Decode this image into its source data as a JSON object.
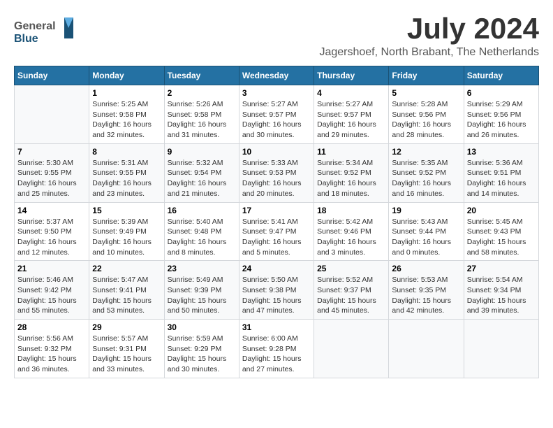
{
  "header": {
    "logo": {
      "general": "General",
      "blue": "Blue"
    },
    "title": "July 2024",
    "location": "Jagershoef, North Brabant, The Netherlands"
  },
  "calendar": {
    "days_of_week": [
      "Sunday",
      "Monday",
      "Tuesday",
      "Wednesday",
      "Thursday",
      "Friday",
      "Saturday"
    ],
    "weeks": [
      [
        {
          "day": "",
          "info": ""
        },
        {
          "day": "1",
          "info": "Sunrise: 5:25 AM\nSunset: 9:58 PM\nDaylight: 16 hours\nand 32 minutes."
        },
        {
          "day": "2",
          "info": "Sunrise: 5:26 AM\nSunset: 9:58 PM\nDaylight: 16 hours\nand 31 minutes."
        },
        {
          "day": "3",
          "info": "Sunrise: 5:27 AM\nSunset: 9:57 PM\nDaylight: 16 hours\nand 30 minutes."
        },
        {
          "day": "4",
          "info": "Sunrise: 5:27 AM\nSunset: 9:57 PM\nDaylight: 16 hours\nand 29 minutes."
        },
        {
          "day": "5",
          "info": "Sunrise: 5:28 AM\nSunset: 9:56 PM\nDaylight: 16 hours\nand 28 minutes."
        },
        {
          "day": "6",
          "info": "Sunrise: 5:29 AM\nSunset: 9:56 PM\nDaylight: 16 hours\nand 26 minutes."
        }
      ],
      [
        {
          "day": "7",
          "info": "Sunrise: 5:30 AM\nSunset: 9:55 PM\nDaylight: 16 hours\nand 25 minutes."
        },
        {
          "day": "8",
          "info": "Sunrise: 5:31 AM\nSunset: 9:55 PM\nDaylight: 16 hours\nand 23 minutes."
        },
        {
          "day": "9",
          "info": "Sunrise: 5:32 AM\nSunset: 9:54 PM\nDaylight: 16 hours\nand 21 minutes."
        },
        {
          "day": "10",
          "info": "Sunrise: 5:33 AM\nSunset: 9:53 PM\nDaylight: 16 hours\nand 20 minutes."
        },
        {
          "day": "11",
          "info": "Sunrise: 5:34 AM\nSunset: 9:52 PM\nDaylight: 16 hours\nand 18 minutes."
        },
        {
          "day": "12",
          "info": "Sunrise: 5:35 AM\nSunset: 9:52 PM\nDaylight: 16 hours\nand 16 minutes."
        },
        {
          "day": "13",
          "info": "Sunrise: 5:36 AM\nSunset: 9:51 PM\nDaylight: 16 hours\nand 14 minutes."
        }
      ],
      [
        {
          "day": "14",
          "info": "Sunrise: 5:37 AM\nSunset: 9:50 PM\nDaylight: 16 hours\nand 12 minutes."
        },
        {
          "day": "15",
          "info": "Sunrise: 5:39 AM\nSunset: 9:49 PM\nDaylight: 16 hours\nand 10 minutes."
        },
        {
          "day": "16",
          "info": "Sunrise: 5:40 AM\nSunset: 9:48 PM\nDaylight: 16 hours\nand 8 minutes."
        },
        {
          "day": "17",
          "info": "Sunrise: 5:41 AM\nSunset: 9:47 PM\nDaylight: 16 hours\nand 5 minutes."
        },
        {
          "day": "18",
          "info": "Sunrise: 5:42 AM\nSunset: 9:46 PM\nDaylight: 16 hours\nand 3 minutes."
        },
        {
          "day": "19",
          "info": "Sunrise: 5:43 AM\nSunset: 9:44 PM\nDaylight: 16 hours\nand 0 minutes."
        },
        {
          "day": "20",
          "info": "Sunrise: 5:45 AM\nSunset: 9:43 PM\nDaylight: 15 hours\nand 58 minutes."
        }
      ],
      [
        {
          "day": "21",
          "info": "Sunrise: 5:46 AM\nSunset: 9:42 PM\nDaylight: 15 hours\nand 55 minutes."
        },
        {
          "day": "22",
          "info": "Sunrise: 5:47 AM\nSunset: 9:41 PM\nDaylight: 15 hours\nand 53 minutes."
        },
        {
          "day": "23",
          "info": "Sunrise: 5:49 AM\nSunset: 9:39 PM\nDaylight: 15 hours\nand 50 minutes."
        },
        {
          "day": "24",
          "info": "Sunrise: 5:50 AM\nSunset: 9:38 PM\nDaylight: 15 hours\nand 47 minutes."
        },
        {
          "day": "25",
          "info": "Sunrise: 5:52 AM\nSunset: 9:37 PM\nDaylight: 15 hours\nand 45 minutes."
        },
        {
          "day": "26",
          "info": "Sunrise: 5:53 AM\nSunset: 9:35 PM\nDaylight: 15 hours\nand 42 minutes."
        },
        {
          "day": "27",
          "info": "Sunrise: 5:54 AM\nSunset: 9:34 PM\nDaylight: 15 hours\nand 39 minutes."
        }
      ],
      [
        {
          "day": "28",
          "info": "Sunrise: 5:56 AM\nSunset: 9:32 PM\nDaylight: 15 hours\nand 36 minutes."
        },
        {
          "day": "29",
          "info": "Sunrise: 5:57 AM\nSunset: 9:31 PM\nDaylight: 15 hours\nand 33 minutes."
        },
        {
          "day": "30",
          "info": "Sunrise: 5:59 AM\nSunset: 9:29 PM\nDaylight: 15 hours\nand 30 minutes."
        },
        {
          "day": "31",
          "info": "Sunrise: 6:00 AM\nSunset: 9:28 PM\nDaylight: 15 hours\nand 27 minutes."
        },
        {
          "day": "",
          "info": ""
        },
        {
          "day": "",
          "info": ""
        },
        {
          "day": "",
          "info": ""
        }
      ]
    ]
  }
}
